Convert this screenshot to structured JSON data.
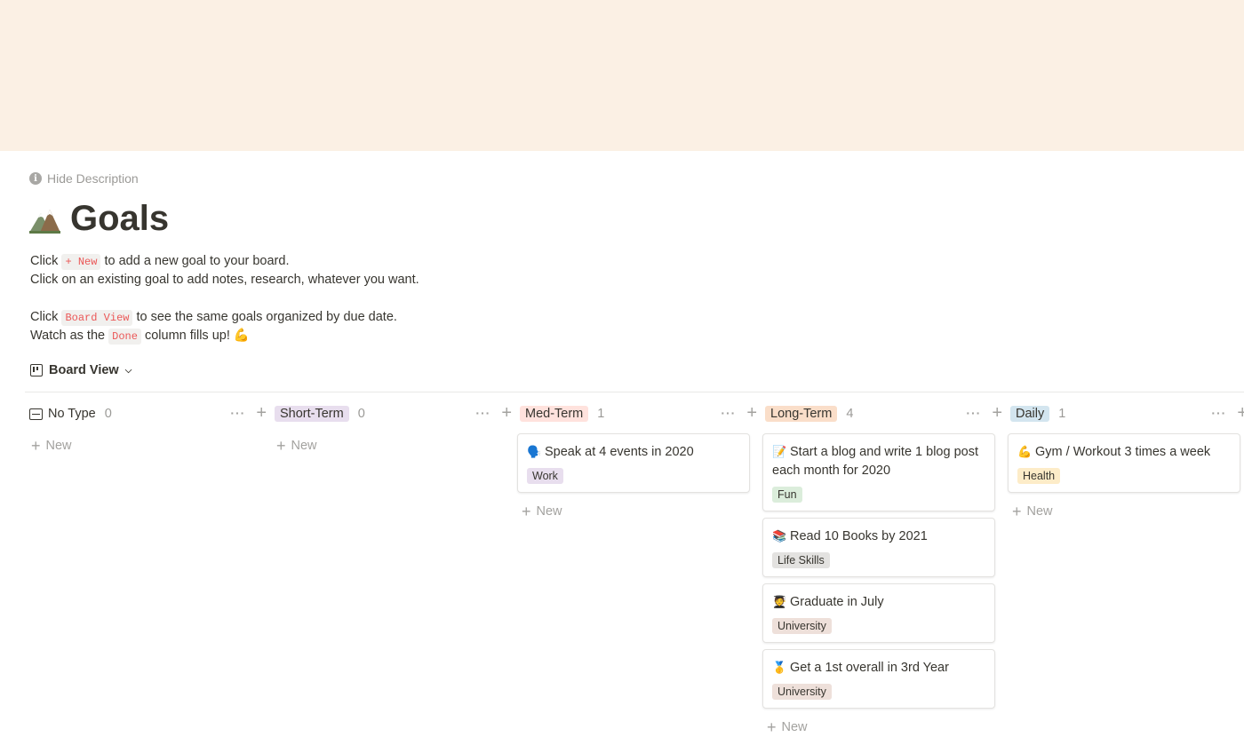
{
  "hide_description": "Hide Description",
  "title": "Goals",
  "description": {
    "line1": {
      "before": "Click",
      "code": "+ New",
      "after": "to add a new goal to your board."
    },
    "line2": "Click on an existing goal to add notes, research, whatever you want.",
    "line3": {
      "before": "Click",
      "code": "Board View",
      "after": "to see the same goals organized by due date."
    },
    "line4": {
      "before": "Watch as the",
      "code": "Done",
      "after": "column fills up! 💪"
    }
  },
  "view_tab": "Board View",
  "new_label": "New",
  "colors": {
    "cover": "#fbf0e4",
    "short_term": "#e8deee",
    "med_term": "#ffe2dd",
    "long_term": "#fadec9",
    "daily": "#d3e5ef",
    "tag_work": "#e8deee",
    "tag_fun": "#dbeddb",
    "tag_life_skills": "#e3e2e0",
    "tag_university": "#eee0da",
    "tag_health": "#fdecc8"
  },
  "columns": [
    {
      "name": "No Type",
      "count": "0"
    },
    {
      "name": "Short-Term",
      "count": "0"
    },
    {
      "name": "Med-Term",
      "count": "1"
    },
    {
      "name": "Long-Term",
      "count": "4"
    },
    {
      "name": "Daily",
      "count": "1"
    }
  ],
  "cards": {
    "med_term": [
      {
        "emoji": "🗣️",
        "title": "Speak at 4 events in 2020",
        "tag": "Work"
      }
    ],
    "long_term": [
      {
        "emoji": "📝",
        "title": "Start a blog and write 1 blog post each month for 2020",
        "tag": "Fun"
      },
      {
        "emoji": "📚",
        "title": "Read 10 Books by 2021",
        "tag": "Life Skills"
      },
      {
        "emoji": "🧑‍🎓",
        "title": "Graduate in July",
        "tag": "University"
      },
      {
        "emoji": "🥇",
        "title": "Get a 1st overall in 3rd Year",
        "tag": "University"
      }
    ],
    "daily": [
      {
        "emoji": "💪",
        "title": "Gym / Workout 3 times a week",
        "tag": "Health"
      }
    ]
  }
}
